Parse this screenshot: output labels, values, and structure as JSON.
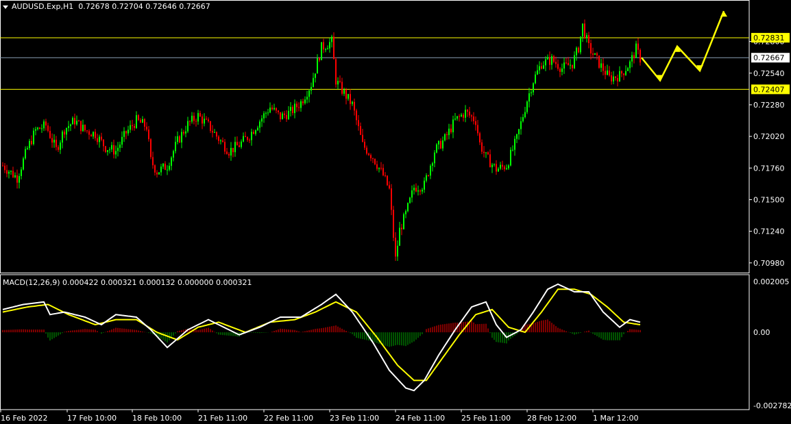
{
  "header": {
    "symbol": "AUDUSD.Exp,H1",
    "ohlc": "0.72678 0.72704 0.72646 0.72667",
    "collapse_icon": "triangle-down-icon"
  },
  "macd_header": "MACD(12,26,9) 0.000422 0.000321 0.000132 0.000000 0.000321",
  "colors": {
    "background": "#000000",
    "bull": "#00ff00",
    "bear": "#ff0000",
    "level": "#ffff00",
    "current_price": "#8a9fb5",
    "macd_line": "#ffffff",
    "signal_line": "#ffff00",
    "hist_up": "#ff0000",
    "hist_down": "#00aa00"
  },
  "chart_data": [
    {
      "type": "candlestick",
      "ylim": [
        0.709,
        0.7304
      ],
      "y_ticks": [
        "0.72800",
        "0.72540",
        "0.72280",
        "0.72020",
        "0.71760",
        "0.71500",
        "0.71240",
        "0.70980"
      ],
      "x_ticks": [
        "16 Feb 2022",
        "17 Feb 10:00",
        "18 Feb 10:00",
        "21 Feb 11:00",
        "22 Feb 11:00",
        "23 Feb 11:00",
        "24 Feb 11:00",
        "25 Feb 11:00",
        "28 Feb 12:00",
        "1 Mar 12:00"
      ],
      "levels": [
        {
          "price": 0.72831,
          "label": "0.72831",
          "color": "#ffff00"
        },
        {
          "price": 0.72407,
          "label": "0.72407",
          "color": "#ffff00"
        }
      ],
      "current_price": {
        "price": 0.72667,
        "label": "0.72667"
      },
      "anchors": [
        [
          0,
          0.7178
        ],
        [
          7,
          0.7168
        ],
        [
          12,
          0.7192
        ],
        [
          16,
          0.7207
        ],
        [
          21,
          0.7211
        ],
        [
          26,
          0.7191
        ],
        [
          30,
          0.7208
        ],
        [
          35,
          0.7215
        ],
        [
          40,
          0.7207
        ],
        [
          45,
          0.7204
        ],
        [
          50,
          0.7193
        ],
        [
          55,
          0.719
        ],
        [
          60,
          0.7205
        ],
        [
          65,
          0.7215
        ],
        [
          70,
          0.721
        ],
        [
          72,
          0.7182
        ],
        [
          75,
          0.7173
        ],
        [
          80,
          0.7178
        ],
        [
          85,
          0.7198
        ],
        [
          90,
          0.7212
        ],
        [
          95,
          0.7219
        ],
        [
          100,
          0.7211
        ],
        [
          105,
          0.72
        ],
        [
          110,
          0.719
        ],
        [
          115,
          0.7195
        ],
        [
          120,
          0.7203
        ],
        [
          125,
          0.7215
        ],
        [
          130,
          0.7226
        ],
        [
          135,
          0.7218
        ],
        [
          140,
          0.7222
        ],
        [
          145,
          0.723
        ],
        [
          150,
          0.7245
        ],
        [
          155,
          0.7275
        ],
        [
          160,
          0.728
        ],
        [
          162,
          0.7248
        ],
        [
          165,
          0.724
        ],
        [
          170,
          0.7228
        ],
        [
          175,
          0.7195
        ],
        [
          180,
          0.7185
        ],
        [
          185,
          0.717
        ],
        [
          188,
          0.7158
        ],
        [
          191,
          0.7101
        ],
        [
          193,
          0.7125
        ],
        [
          196,
          0.7138
        ],
        [
          200,
          0.716
        ],
        [
          205,
          0.7162
        ],
        [
          210,
          0.719
        ],
        [
          215,
          0.72
        ],
        [
          220,
          0.7215
        ],
        [
          225,
          0.7222
        ],
        [
          230,
          0.7215
        ],
        [
          232,
          0.7196
        ],
        [
          235,
          0.7185
        ],
        [
          240,
          0.7175
        ],
        [
          245,
          0.7178
        ],
        [
          250,
          0.72
        ],
        [
          255,
          0.7232
        ],
        [
          258,
          0.7248
        ],
        [
          262,
          0.7262
        ],
        [
          267,
          0.7265
        ],
        [
          272,
          0.7258
        ],
        [
          277,
          0.7262
        ],
        [
          280,
          0.7275
        ],
        [
          282,
          0.7293
        ],
        [
          285,
          0.7275
        ],
        [
          290,
          0.7262
        ],
        [
          295,
          0.725
        ],
        [
          300,
          0.7252
        ],
        [
          305,
          0.7262
        ],
        [
          308,
          0.7274
        ],
        [
          310,
          0.7266
        ]
      ],
      "projection": {
        "label": "forecast-arrow",
        "points": [
          [
            0.72667,
            0
          ],
          [
            0.7248,
            1
          ],
          [
            0.7276,
            2
          ],
          [
            0.7256,
            3
          ],
          [
            0.7305,
            4
          ]
        ]
      }
    },
    {
      "type": "macd",
      "params": "12,26,9",
      "ylim": [
        -0.002782,
        0.002005
      ],
      "y_ticks": [
        "0.002005",
        "0.00",
        "-0.002782"
      ],
      "macd_anchors": [
        [
          0,
          0.0009
        ],
        [
          10,
          0.0011
        ],
        [
          20,
          0.0012
        ],
        [
          23,
          0.0007
        ],
        [
          30,
          0.0008
        ],
        [
          40,
          0.0006
        ],
        [
          48,
          0.0003
        ],
        [
          55,
          0.0007
        ],
        [
          65,
          0.0006
        ],
        [
          72,
          0.0001
        ],
        [
          80,
          -0.0006
        ],
        [
          90,
          0.0001
        ],
        [
          100,
          0.0005
        ],
        [
          105,
          0.0003
        ],
        [
          115,
          -0.0001
        ],
        [
          125,
          0.0002
        ],
        [
          135,
          0.0006
        ],
        [
          145,
          0.0006
        ],
        [
          155,
          0.0011
        ],
        [
          162,
          0.0015
        ],
        [
          170,
          0.0008
        ],
        [
          180,
          -0.0004
        ],
        [
          188,
          -0.0015
        ],
        [
          196,
          -0.0022
        ],
        [
          200,
          -0.0023
        ],
        [
          205,
          -0.0019
        ],
        [
          212,
          -0.0009
        ],
        [
          220,
          0.0001
        ],
        [
          228,
          0.001
        ],
        [
          235,
          0.0012
        ],
        [
          240,
          0.0003
        ],
        [
          245,
          -0.0002
        ],
        [
          252,
          0.0001
        ],
        [
          258,
          0.0008
        ],
        [
          265,
          0.0017
        ],
        [
          270,
          0.0019
        ],
        [
          278,
          0.0016
        ],
        [
          285,
          0.0016
        ],
        [
          292,
          0.0008
        ],
        [
          300,
          0.0002
        ],
        [
          305,
          0.0005
        ],
        [
          310,
          0.0004
        ]
      ],
      "signal_anchors": [
        [
          0,
          0.0008
        ],
        [
          12,
          0.001
        ],
        [
          22,
          0.0011
        ],
        [
          32,
          0.0007
        ],
        [
          45,
          0.0003
        ],
        [
          55,
          0.0005
        ],
        [
          65,
          0.0005
        ],
        [
          75,
          0.0
        ],
        [
          85,
          -0.0003
        ],
        [
          95,
          0.0002
        ],
        [
          105,
          0.0004
        ],
        [
          118,
          0.0
        ],
        [
          130,
          0.0004
        ],
        [
          142,
          0.0005
        ],
        [
          152,
          0.0008
        ],
        [
          162,
          0.0012
        ],
        [
          172,
          0.0008
        ],
        [
          182,
          -0.0002
        ],
        [
          192,
          -0.0013
        ],
        [
          200,
          -0.0019
        ],
        [
          206,
          -0.0019
        ],
        [
          214,
          -0.001
        ],
        [
          222,
          -0.0001
        ],
        [
          230,
          0.0007
        ],
        [
          238,
          0.0009
        ],
        [
          246,
          0.0002
        ],
        [
          254,
          0.0
        ],
        [
          262,
          0.0008
        ],
        [
          270,
          0.0017
        ],
        [
          278,
          0.0017
        ],
        [
          286,
          0.0015
        ],
        [
          294,
          0.001
        ],
        [
          302,
          0.0004
        ],
        [
          310,
          0.0003
        ]
      ]
    }
  ]
}
